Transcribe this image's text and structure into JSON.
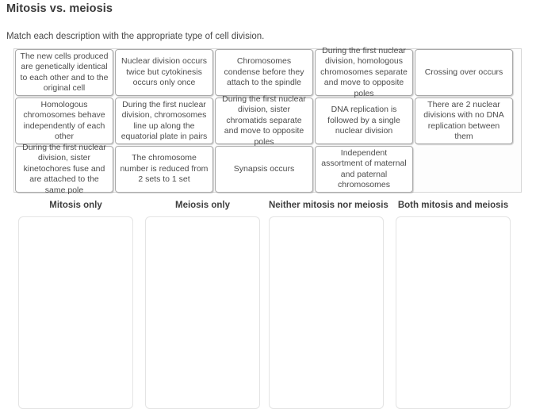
{
  "header": {
    "title": "Mitosis vs. meiosis",
    "instructions": "Match each description with the appropriate type of cell division."
  },
  "cards": [
    {
      "text": "The new cells produced are genetically identical to each other and to the original cell"
    },
    {
      "text": "Nuclear division occurs twice but cytokinesis occurs only once"
    },
    {
      "text": "Chromosomes condense before they attach to the spindle"
    },
    {
      "text": "During the first nuclear division, homologous chromosomes separate and move to opposite poles"
    },
    {
      "text": "Crossing over occurs"
    },
    {
      "text": "Homologous chromosomes behave independently of each other"
    },
    {
      "text": "During the first nuclear division, chromosomes line up along the equatorial plate in pairs"
    },
    {
      "text": "During the first nuclear division, sister chromatids separate and move to opposite poles"
    },
    {
      "text": "DNA replication is followed by a single nuclear division"
    },
    {
      "text": "There are 2 nuclear divisions with no DNA replication between them"
    },
    {
      "text": "During the first nuclear division, sister kinetochores fuse and are attached to the same pole"
    },
    {
      "text": "The chromosome number is reduced from 2 sets to 1 set"
    },
    {
      "text": "Synapsis occurs"
    },
    {
      "text": "Independent assortment of maternal and paternal chromosomes"
    }
  ],
  "columns": [
    {
      "label": "Mitosis only",
      "items": []
    },
    {
      "label": "Meiosis only",
      "items": []
    },
    {
      "label": "Neither mitosis nor meiosis",
      "items": []
    },
    {
      "label": "Both mitosis and meiosis",
      "items": []
    }
  ],
  "colors": {
    "card_border": "#a9a9a9",
    "dropzone_border": "#e4e4e4",
    "tray_border": "#d6d6d6",
    "text": "#4c4c4c",
    "heading": "#3a3a3a"
  }
}
